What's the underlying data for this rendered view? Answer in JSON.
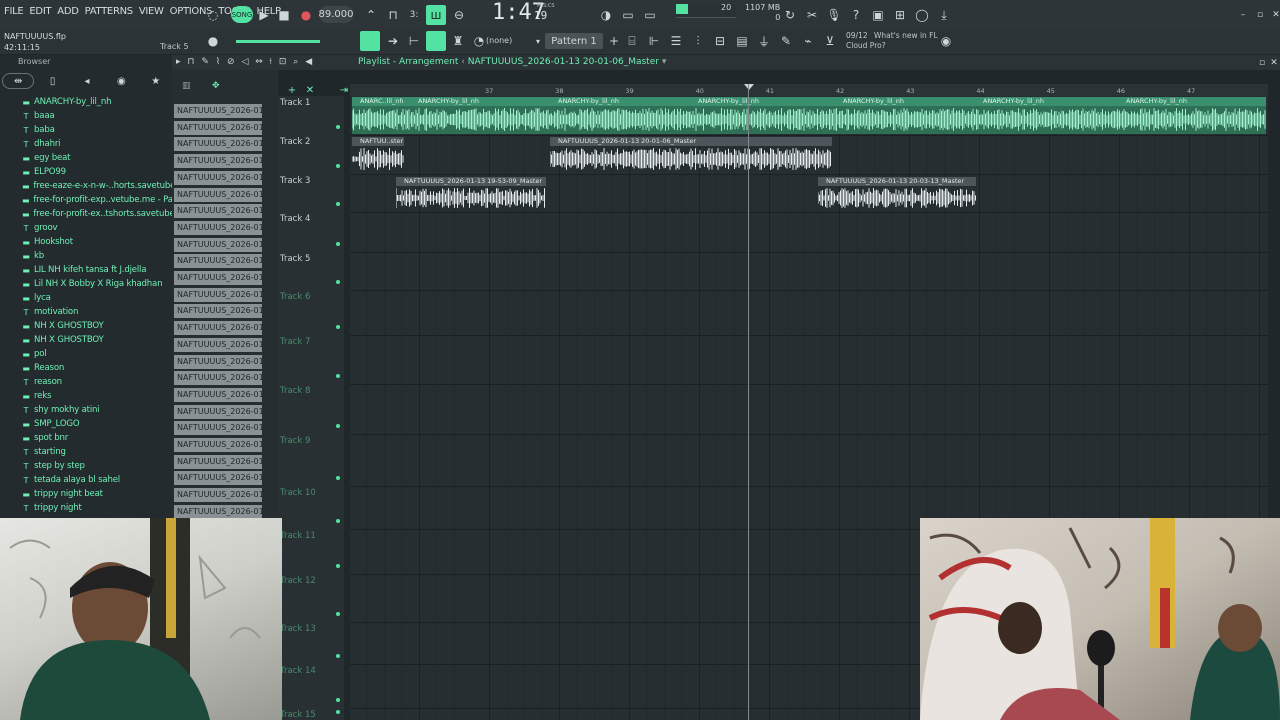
{
  "menu": [
    "FILE",
    "EDIT",
    "ADD",
    "PATTERNS",
    "VIEW",
    "OPTIONS",
    "TOOLS",
    "HELP"
  ],
  "transport": {
    "mode_label": "SONG",
    "tempo": "89.000",
    "time_main": "1:47",
    "time_sub": "19",
    "time_unit": "M:S:CS"
  },
  "meters": {
    "cpu_number": "20",
    "memory": "1107 MB",
    "voices": "0"
  },
  "file": {
    "name": "NAFTUUUUS.flp",
    "time": "42:11:15",
    "hint": "Track 5"
  },
  "toolbar2": {
    "snap": "(none)",
    "pattern": "Pattern 1",
    "news_date": "09/12",
    "news_line1": "What's new in FL",
    "news_line2": "Cloud Pro?"
  },
  "browser": {
    "title": "Browser",
    "items": [
      {
        "icon": "folder-icon",
        "label": "ANARCHY-by_lil_nh"
      },
      {
        "icon": "text-icon",
        "label": "baaa"
      },
      {
        "icon": "text-icon",
        "label": "baba"
      },
      {
        "icon": "text-icon",
        "label": "dhahri"
      },
      {
        "icon": "folder-icon",
        "label": "egy beat"
      },
      {
        "icon": "folder-icon",
        "label": "ELPO99"
      },
      {
        "icon": "folder-icon",
        "label": "free-eaze-e-x-n-w-..horts.savetube.me"
      },
      {
        "icon": "folder-icon",
        "label": "free-for-profit-exp..vetube.me - Part_2"
      },
      {
        "icon": "folder-icon",
        "label": "free-for-profit-ex..tshorts.savetube.me"
      },
      {
        "icon": "text-icon",
        "label": "groov"
      },
      {
        "icon": "folder-icon",
        "label": "Hookshot"
      },
      {
        "icon": "folder-icon",
        "label": "kb"
      },
      {
        "icon": "folder-icon",
        "label": "LIL NH kifeh tansa ft J.djella"
      },
      {
        "icon": "folder-icon",
        "label": "Lil NH X Bobby X Riga khadhan"
      },
      {
        "icon": "folder-icon",
        "label": "lyca"
      },
      {
        "icon": "text-icon",
        "label": "motivation"
      },
      {
        "icon": "folder-icon",
        "label": "NH X GHOSTBOY"
      },
      {
        "icon": "folder-icon",
        "label": "NH X GHOSTBOY"
      },
      {
        "icon": "folder-icon",
        "label": "pol"
      },
      {
        "icon": "folder-icon",
        "label": "Reason"
      },
      {
        "icon": "text-icon",
        "label": "reason"
      },
      {
        "icon": "folder-icon",
        "label": "reks"
      },
      {
        "icon": "text-icon",
        "label": "shy mokhy atini"
      },
      {
        "icon": "folder-icon",
        "label": "SMP_LOGO"
      },
      {
        "icon": "folder-icon",
        "label": "spot bnr"
      },
      {
        "icon": "text-icon",
        "label": "starting"
      },
      {
        "icon": "text-icon",
        "label": "step by step"
      },
      {
        "icon": "text-icon",
        "label": "tetada alaya bl sahel"
      },
      {
        "icon": "folder-icon",
        "label": "trippy night beat"
      },
      {
        "icon": "text-icon",
        "label": "trippy night"
      }
    ]
  },
  "clip_list": {
    "label": "NAFTUUUUS_2026-01-13...",
    "count": 25
  },
  "playlist": {
    "title_prefix": "Playlist - Arrangement",
    "title_pattern": "NAFTUUUUS_2026-01-13 20-01-06_Master",
    "bar_numbers": [
      "37",
      "38",
      "39",
      "40",
      "41",
      "42",
      "43",
      "44",
      "45",
      "46",
      "47"
    ],
    "tracks": [
      "Track 1",
      "Track 2",
      "Track 3",
      "Track 4",
      "Track 5",
      "Track 6",
      "Track 7",
      "Track 8",
      "Track 9",
      "Track 10",
      "Track 11",
      "Track 12",
      "Track 13",
      "Track 14",
      "Track 15"
    ],
    "clips": {
      "track1_a": "ANARC..lil_nh",
      "track1_b": "ANARCHY-by_lil_nh",
      "track2_a": "NAFTUU..ster",
      "track2_b": "NAFTUUUUS_2026-01-13 20-01-06_Master",
      "track3_a": "NAFTUUUUS_2026-01-13 19-53-09_Master",
      "track3_b": "NAFTUUUUS_2026-01-13 20-03-13_Master"
    }
  },
  "colors": {
    "accent": "#53e2a1",
    "background": "#262e32",
    "clip_green": "#2e6f56",
    "clip_grey": "#4d575b"
  }
}
